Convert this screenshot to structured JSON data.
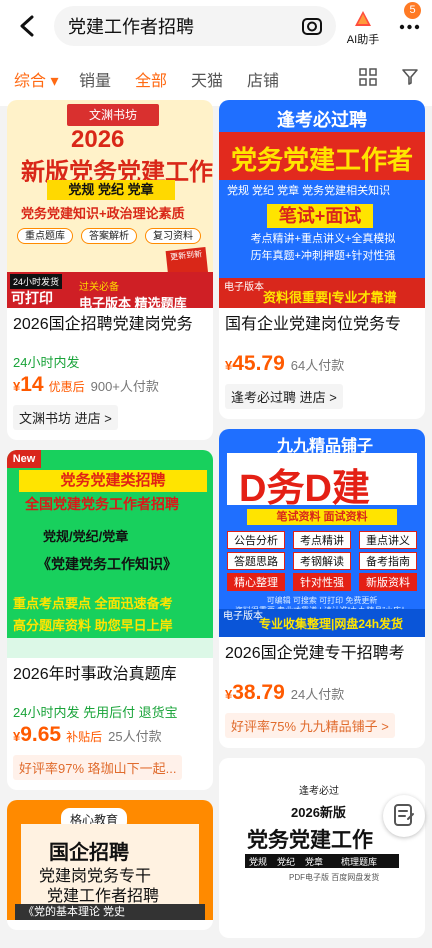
{
  "header": {
    "search_text": "党建工作者招聘",
    "ai_label": "AI助手",
    "badge": "5"
  },
  "filters": {
    "sort": "综合",
    "sales": "销量",
    "all": "全部",
    "tmall": "天猫",
    "shop": "店铺"
  },
  "colors": {
    "accent": "#ff6a13",
    "price": "#ff5a00",
    "green": "#1aa43a",
    "page_bg": "#f3f3f3"
  },
  "products": [
    {
      "poster": {
        "top": "文渊书坊",
        "year": "2026",
        "main": "新版党务党建工作",
        "band": "党规 党纪 党章",
        "sub": "党务党建知识+政治理论素质",
        "pill1": "重点题库",
        "pill2": "答案解析",
        "pill3": "复习资料",
        "seal": "更新到新",
        "p24": "24小时发货",
        "print": "可打印",
        "yellow_a": "过关必备",
        "yellow_b": "电子版本 精选题库"
      },
      "title": "2026国企招聘党建岗党务",
      "green": "24小时内发",
      "price": "14",
      "price_note": "优惠后",
      "sold": "900+人付款",
      "shop": "文渊书坊 进店 >"
    },
    {
      "poster": {
        "head": "逢考必过聘",
        "big": "党务党建工作者",
        "line": "党规 党纪 党章 党务党建相关知识",
        "ribbon": "笔试+面试",
        "lines": [
          "考点精讲+重点讲义+全真模拟",
          "历年真题+冲刺押题+针对性强"
        ],
        "foot_tag": "电子版本",
        "foot_main": "资料很重要|专业才靠谱"
      },
      "title": "国有企业党建岗位党务专",
      "price": "45.79",
      "sold": "64人付款",
      "shop": "逢考必过聘 进店 >"
    },
    {
      "poster": {
        "new": "New",
        "top": "党务党建类招聘",
        "red": "全国党建党务工作者招聘",
        "band": "党规/党纪/党章",
        "book": "《党建党务工作知识》",
        "slogan1": "重点考点要点 全面迅速备考",
        "slogan2": "高分题库资料 助您早日上岸"
      },
      "title": "2026年时事政治真题库",
      "green": "24小时内发 先用后付 退货宝",
      "price": "9.65",
      "price_note": "补贴后",
      "sold": "25人付款",
      "chip": "好评率97% 珞珈山下一起..."
    },
    {
      "poster": {
        "top": "九九精品铺子",
        "big": "D务D建",
        "strip": "笔试资料 面试资料",
        "tags": [
          "公告分析",
          "考点精讲",
          "重点讲义",
          "答题思路",
          "考钢解读",
          "备考指南",
          "精心整理",
          "针对性强",
          "新版资料"
        ],
        "hint1": "可编辑 可搜索 可打印 免费更新",
        "hint2": "资料很重要 专业才靠谱 | 请认准“九九精品”小店！",
        "foot_tag": "电子版本",
        "foot_main": "专业收集整理|网盘24h发货"
      },
      "title": "2026国企党建专干招聘考",
      "price": "38.79",
      "sold": "24人付款",
      "chip": "好评率75% 九九精品铺子 >"
    },
    {
      "poster": {
        "logo": "格心教育",
        "line1": "国企招聘",
        "line2": "党建岗党务专干",
        "line3": "党建工作者招聘",
        "line4": "《党的基本理论 党史"
      }
    },
    {
      "poster": {
        "stamp": "逢考必过",
        "new": "2026新版",
        "big": "党务党建工作",
        "tags": [
          "党规",
          "党纪",
          "党章",
          "梳理题库"
        ],
        "foot": "PDF电子版  百度网盘发货"
      }
    }
  ]
}
